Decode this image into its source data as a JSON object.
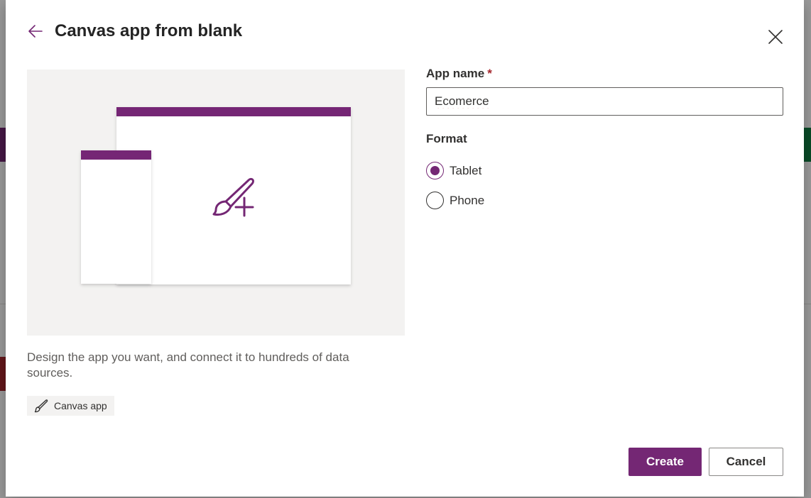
{
  "dialog": {
    "title": "Canvas app from blank",
    "description": "Design the app you want, and connect it to hundreds of data sources.",
    "tag_label": "Canvas app"
  },
  "form": {
    "app_name_label": "App name",
    "required_mark": "*",
    "app_name_value": "Ecomerce",
    "format_label": "Format",
    "format_options": [
      {
        "label": "Tablet",
        "selected": true
      },
      {
        "label": "Phone",
        "selected": false
      }
    ]
  },
  "actions": {
    "create_label": "Create",
    "cancel_label": "Cancel"
  },
  "icons": {
    "back": "arrow-left-icon",
    "close": "close-icon",
    "brush_add": "paintbrush-add-icon",
    "tag": "paintbrush-icon"
  },
  "colors": {
    "brand": "#742774",
    "required": "#a4262c",
    "preview_bg": "#f3f2f1"
  }
}
